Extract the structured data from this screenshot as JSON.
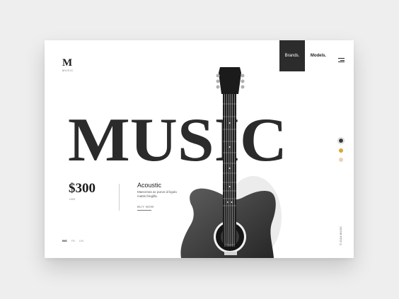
{
  "logo": {
    "mark": "M",
    "sub": "MUSIC"
  },
  "nav": {
    "brands": "Brands.",
    "models": "Models."
  },
  "hero": {
    "title": "MUSIC"
  },
  "product": {
    "price": "$300",
    "currency": "USD",
    "name": "Acoustic",
    "description": "Maecenas ac purus id ligula mattis fringilla.",
    "cta": "BUY NOW"
  },
  "social": [
    "INS",
    "FB",
    "LIN"
  ],
  "color_options": [
    "#3a3a3a",
    "#d9a82f",
    "#e9d2bb"
  ],
  "copyright": "© 2018 MUSIC",
  "colors": {
    "dark_panel": "#2c2c2c",
    "text": "#1c1c1c",
    "background": "#eeeeee"
  }
}
